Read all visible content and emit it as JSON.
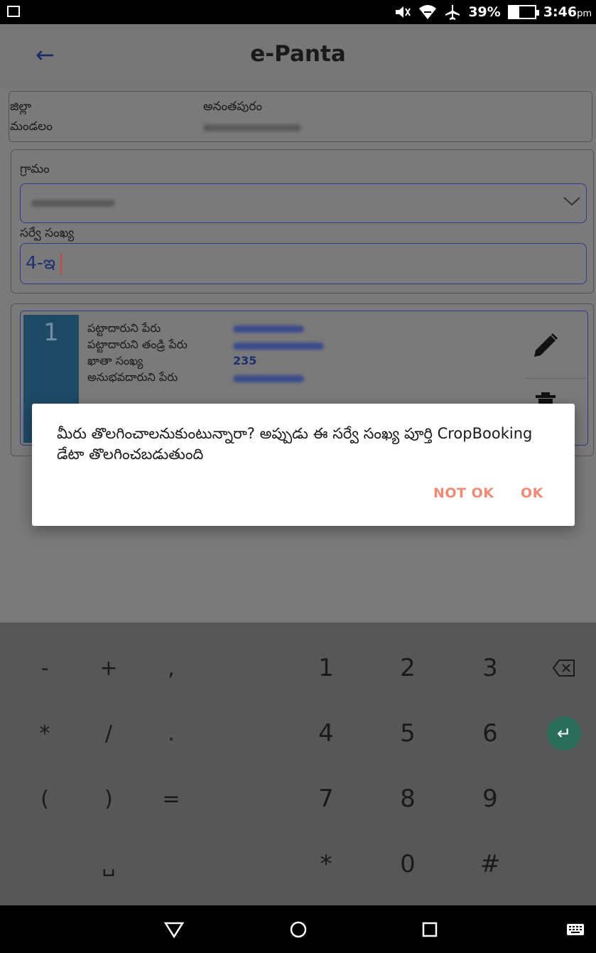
{
  "status_bar": {
    "battery_percent_label": "39%",
    "battery_level": 0.39,
    "time": "3:46",
    "time_suffix": "pm",
    "icons": [
      "screenshot-icon",
      "mute-icon",
      "wifi-icon",
      "airplane-icon",
      "battery-icon"
    ]
  },
  "app_bar": {
    "title": "e-Panta",
    "back_icon": "arrow-left-icon"
  },
  "location": {
    "district_label": "జిల్లా",
    "district_value": "అనంతపురం",
    "mandal_label": "మండలం"
  },
  "search": {
    "village_label": "గ్రామం",
    "survey_label": "సర్వే సంఖ్య",
    "survey_value": "4-ఇ"
  },
  "record": {
    "index": "1",
    "pattadar_name_label": "పట్టాదారుని పేరు",
    "pattadar_father_label": "పట్టాదారుని తండ్రి పేరు",
    "khata_label": "ఖాతా సంఖ్య",
    "khata_value": "235",
    "anubhavadar_label": "అనుభవదారుని పేరు"
  },
  "dialog": {
    "message": "మీరు తొలగించాలనుకుంటున్నారా? అప్పుడు ఈ సర్వే సంఖ్య పూర్తి CropBooking డేటా తొలగించబడుతుంది",
    "not_ok_label": "NOT OK",
    "ok_label": "OK"
  },
  "keyboard": {
    "rows": [
      [
        "-",
        "+",
        ",",
        "1",
        "2",
        "3"
      ],
      [
        "*",
        "/",
        ".",
        "4",
        "5",
        "6"
      ],
      [
        "(",
        ")",
        "=",
        "7",
        "8",
        "9"
      ],
      [
        "",
        "",
        "",
        "*",
        "0",
        "#"
      ]
    ],
    "space_symbol": "␣"
  },
  "colors": {
    "accent": "#f08a75",
    "field_border": "#2b3d8a",
    "index_block": "#1f4a66",
    "enter_key": "#2a6e59"
  }
}
